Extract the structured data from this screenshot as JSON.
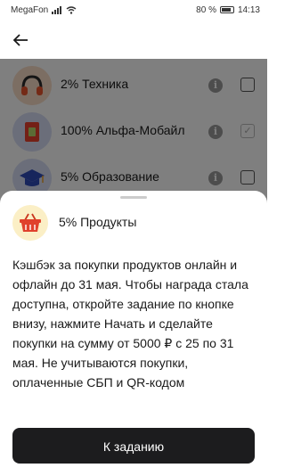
{
  "status_bar": {
    "carrier": "MegaFon",
    "battery": "80 %",
    "time": "14:13"
  },
  "header": {
    "back_icon": "arrow-left-icon"
  },
  "categories": [
    {
      "label": "2% Техника",
      "icon": "headphones-icon",
      "checked": false
    },
    {
      "label": "100% Альфа-Мобайл",
      "icon": "sim-card-icon",
      "checked": true
    },
    {
      "label": "5% Образование",
      "icon": "graduation-cap-icon",
      "checked": false
    }
  ],
  "sheet": {
    "icon": "basket-icon",
    "title": "5% Продукты",
    "description": "Кэшбэк за покупки продуктов онлайн и офлайн до 31 мая. Чтобы награда стала доступна, откройте задание по кнопке внизу, нажмите Начать и сделайте покупки на сумму от 5000 ₽ с 25 по 31 мая. Не учитываются покупки, оплаченные СБП и QR-кодом",
    "button_label": "К заданию"
  },
  "colors": {
    "overlay": "#000000",
    "button_bg": "#1c1c1e",
    "sheet_icon_bg": "#fbefc6"
  }
}
